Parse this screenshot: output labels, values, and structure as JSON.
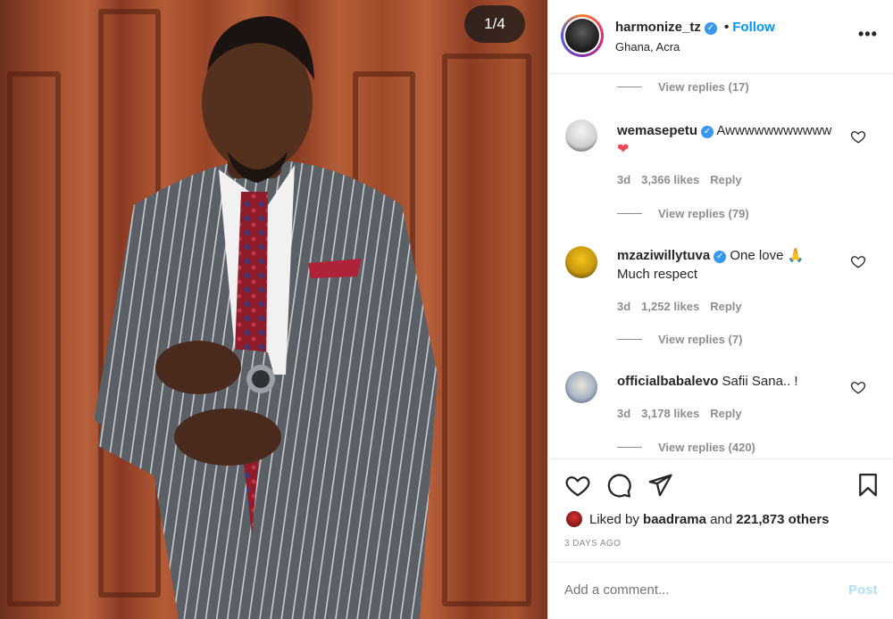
{
  "photo": {
    "counter": "1/4",
    "alt_subject": "man in grey pinstripe suit with red tie"
  },
  "header": {
    "username": "harmonize_tz",
    "verified_icon": "verified-badge-icon",
    "follow_separator": "•",
    "follow_label": "Follow",
    "location": "Ghana, Acra",
    "more_label": "•••"
  },
  "comments": {
    "top_view_replies": "View replies (17)",
    "items": [
      {
        "username": "wemasepetu",
        "text": "Awwwwwwwwwww",
        "emoji": "❤",
        "time": "3d",
        "likes": "3,366 likes",
        "reply": "Reply",
        "view_replies": "View replies (79)"
      },
      {
        "username": "mzaziwillytuva",
        "text": "One love 🙏",
        "text2": "Much respect",
        "time": "3d",
        "likes": "1,252 likes",
        "reply": "Reply",
        "view_replies": "View replies (7)"
      },
      {
        "username": "officialbabalevo",
        "text": "Safii Sana.. !",
        "time": "3d",
        "likes": "3,178 likes",
        "reply": "Reply",
        "view_replies": "View replies (420)"
      }
    ]
  },
  "actions": {
    "liked_prefix": "Liked by",
    "liked_user": "baadrama",
    "liked_and": "and",
    "liked_count": "221,873 others",
    "time_ago": "3 DAYS AGO"
  },
  "add_comment": {
    "placeholder": "Add a comment...",
    "post_label": "Post"
  },
  "colors": {
    "accent": "#0095f6",
    "verified": "#3897f0",
    "muted": "#8e8e8e",
    "post_disabled": "#b2dffc",
    "heart_red": "#ed4956"
  }
}
